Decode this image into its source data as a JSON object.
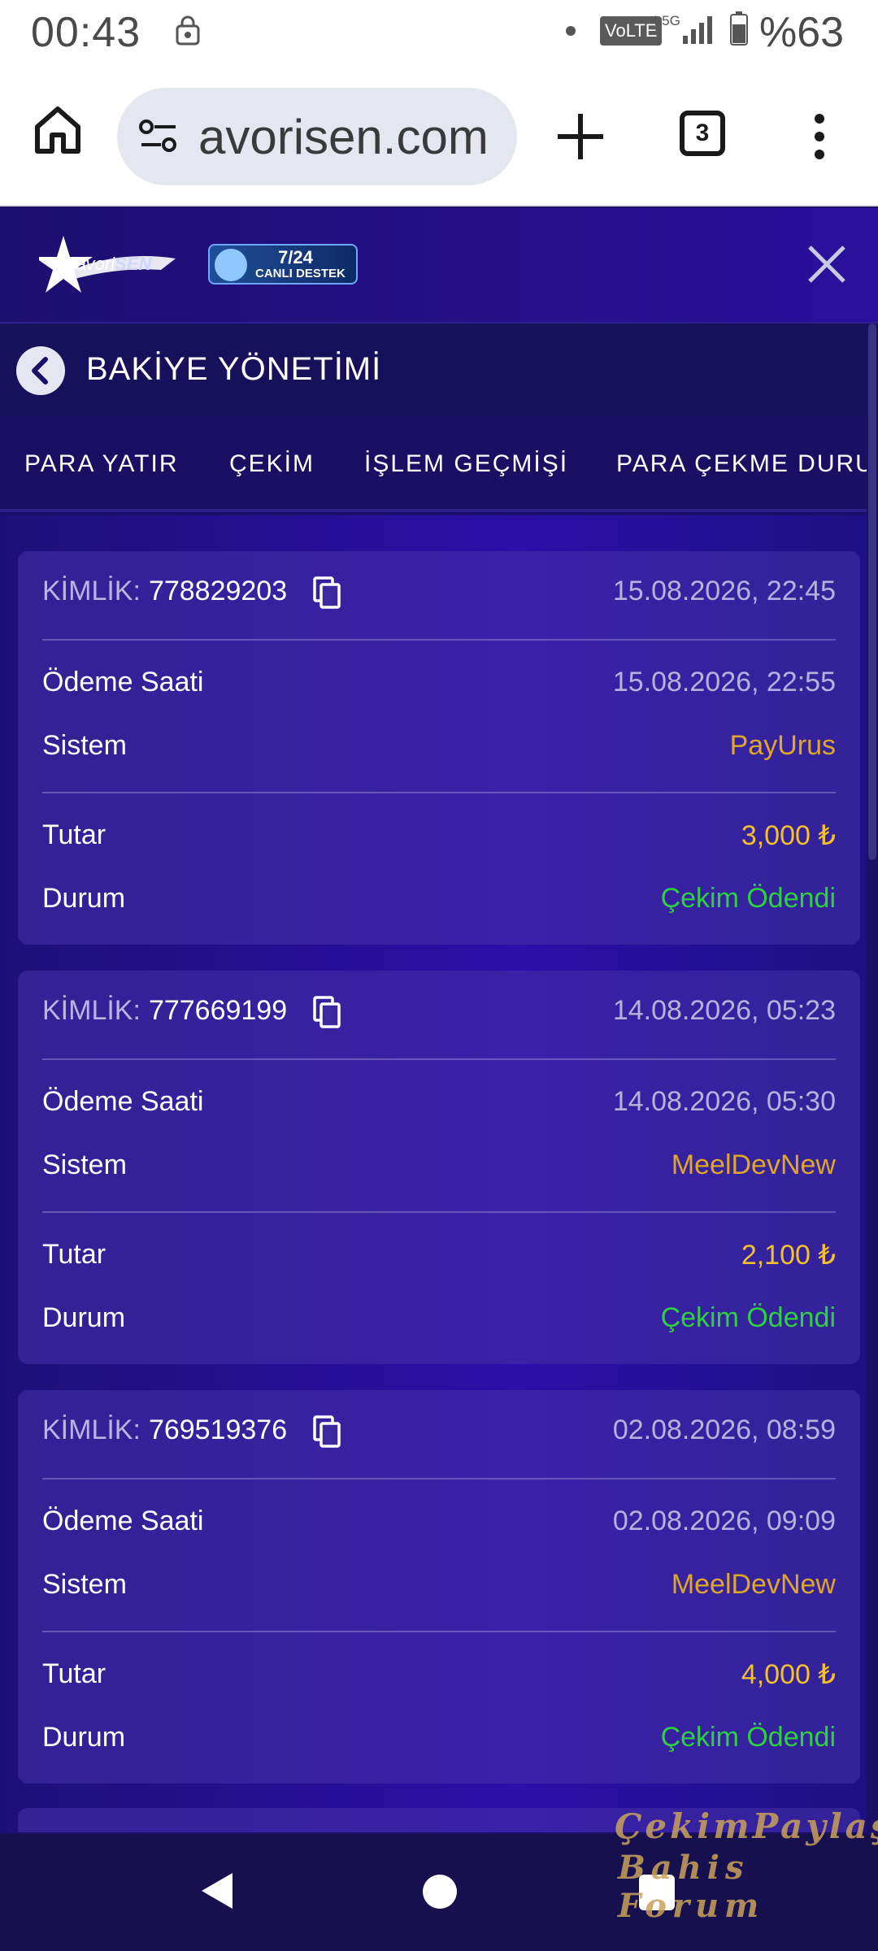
{
  "status_bar": {
    "time": "00:43",
    "network_badge": "VoLTE",
    "network_type": "4.5G",
    "battery_percent": "%63"
  },
  "browser": {
    "url": "avorisen.com",
    "tab_count": "3"
  },
  "site": {
    "logo_text_a": "Favori",
    "logo_text_b": "SEN",
    "support_badge_top": "7/24",
    "support_badge_bottom": "CANLI DESTEK"
  },
  "page": {
    "title": "BAKİYE YÖNETİMİ"
  },
  "tabs": [
    {
      "label": "PARA YATIR",
      "active": false
    },
    {
      "label": "ÇEKİM",
      "active": false
    },
    {
      "label": "İŞLEM GEÇMİŞİ",
      "active": false
    },
    {
      "label": "PARA ÇEKME DURUMU",
      "active": true
    }
  ],
  "labels": {
    "id": "KİMLİK:",
    "payment_time": "Ödeme Saati",
    "system": "Sistem",
    "amount": "Tutar",
    "status": "Durum"
  },
  "withdrawals": [
    {
      "id": "778829203",
      "date": "15.08.2026, 22:45",
      "payment_time": "15.08.2026, 22:55",
      "system": "PayUrus",
      "amount": "3,000 ₺",
      "status": "Çekim Ödendi"
    },
    {
      "id": "777669199",
      "date": "14.08.2026, 05:23",
      "payment_time": "14.08.2026, 05:30",
      "system": "MeelDevNew",
      "amount": "2,100 ₺",
      "status": "Çekim Ödendi"
    },
    {
      "id": "769519376",
      "date": "02.08.2026, 08:59",
      "payment_time": "02.08.2026, 09:09",
      "system": "MeelDevNew",
      "amount": "4,000 ₺",
      "status": "Çekim Ödendi"
    }
  ],
  "watermark": {
    "line1": "ÇekimPaylaş",
    "line2": "Bahis Forum"
  },
  "colors": {
    "accent_yellow": "#f2c83a",
    "status_green": "#2ed13e",
    "system_orange": "#e0a629",
    "background_purple": "#2b0fa8"
  }
}
